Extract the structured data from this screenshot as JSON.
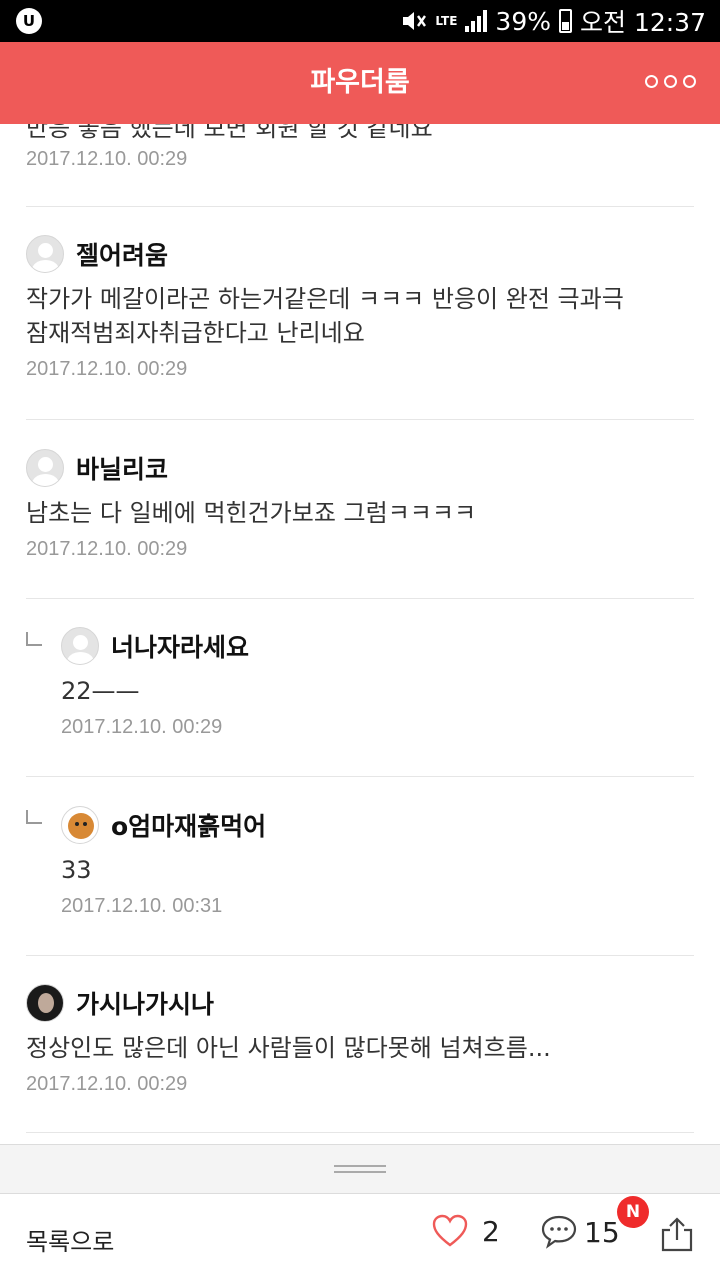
{
  "status_bar": {
    "carrier": "U",
    "network": "LTE",
    "battery": "39%",
    "time": "오전 12:37"
  },
  "header": {
    "title": "파우더룸"
  },
  "partial_comment": {
    "text": "반응 좋음 했는데 보면 회원 할 것 같네요",
    "date": "2017.12.10. 00:29"
  },
  "comments": [
    {
      "name": "젤어려움",
      "text_lines": [
        "작가가 메갈이라곤 하는거같은데 ㅋㅋㅋ 반응이 완전 극과극",
        "잠재적범죄자취급한다고 난리네요"
      ],
      "date": "2017.12.10. 00:29",
      "reply": false
    },
    {
      "name": "바닐리코",
      "text_lines": [
        "남초는 다 일베에 먹힌건가보죠 그럼ㅋㅋㅋㅋ"
      ],
      "date": "2017.12.10. 00:29",
      "reply": false
    },
    {
      "name": "너나자라세요",
      "text_lines": [
        "22——"
      ],
      "date": "2017.12.10. 00:29",
      "reply": true
    },
    {
      "name": "o엄마재흙먹어",
      "text_lines": [
        "33"
      ],
      "date": "2017.12.10. 00:31",
      "reply": true
    },
    {
      "name": "가시나가시나",
      "text_lines": [
        "정상인도 많은데 아닌 사람들이 많다못해 넘쳐흐름..."
      ],
      "date": "2017.12.10. 00:29",
      "reply": false
    }
  ],
  "bottom_bar": {
    "list_label": "목록으로",
    "like_count": "2",
    "comment_count": "15",
    "new_badge": "N"
  },
  "colors": {
    "accent": "#ef5a58",
    "badge": "#ef2b2b"
  }
}
